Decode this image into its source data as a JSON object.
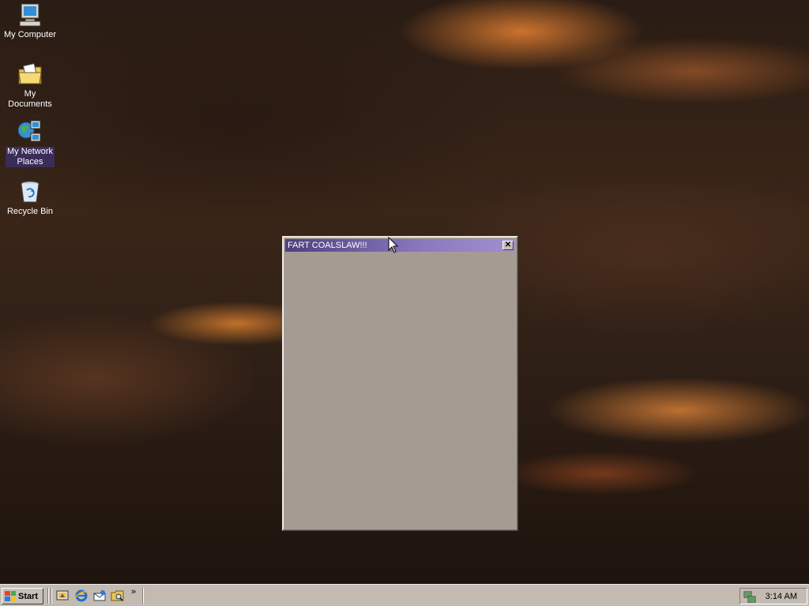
{
  "desktop": {
    "icons": [
      {
        "label": "My Computer",
        "icon": "my-computer-icon"
      },
      {
        "label": "My Documents",
        "icon": "my-documents-icon"
      },
      {
        "label": "My Network Places",
        "label_line1": "My Network",
        "label_line2": "Places",
        "icon": "network-places-icon",
        "selected": true
      },
      {
        "label": "Recycle Bin",
        "icon": "recycle-bin-icon"
      }
    ]
  },
  "window": {
    "title": "FART COALSLAW!!!",
    "close_glyph": "✕",
    "titlebar_color": "#4d3f80",
    "body_color": "#a69b93"
  },
  "taskbar": {
    "start_label": "Start",
    "chevron": "»",
    "quick_launch": [
      "show-desktop-icon",
      "internet-explorer-icon",
      "outlook-express-icon",
      "windows-explorer-icon"
    ],
    "clock": "3:14 AM",
    "tray_icon": "network-tray-icon"
  }
}
